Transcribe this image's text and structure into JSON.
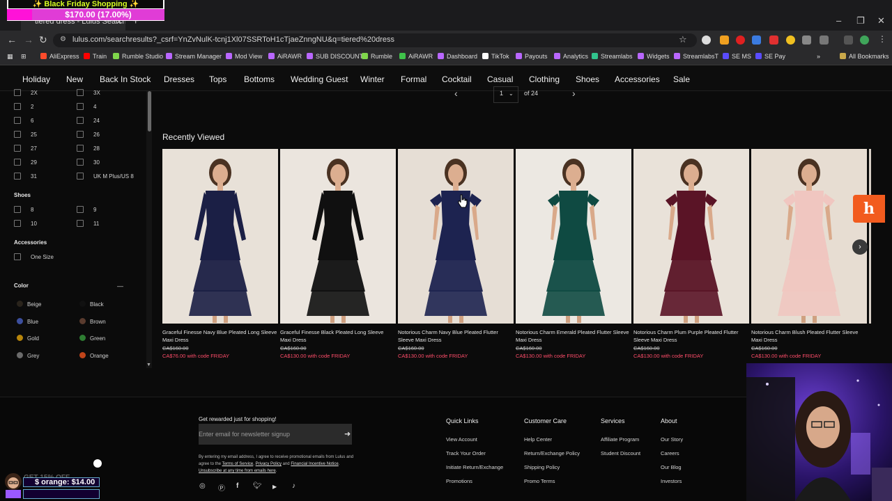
{
  "overlay": {
    "black_friday_title": "✨ Black Friday Shopping ✨",
    "black_friday_amount": "$170.00 (17.00%)",
    "promo_faint": "GET 15% OFF",
    "promo_line": "$ orange: $14.00"
  },
  "browser": {
    "tab_title": "tiered dress - Lulus Search",
    "url": "lulus.com/searchresults?_csrf=YnZvNulK-tcnj1Xl07SSRToH1cTjaeZnngNU&q=tiered%20dress",
    "bookmarks": [
      "AliExpress",
      "Train",
      "Rumble Studio",
      "Stream Manager",
      "Mod View",
      "AiRAWR",
      "SUB DISCOUNT",
      "Rumble",
      "AiRAWR",
      "Dashboard",
      "TikTok",
      "Payouts",
      "Analytics",
      "Streamlabs",
      "Widgets",
      "StreamlabsT",
      "SE MS",
      "SE Pay"
    ],
    "all_bookmarks": "All Bookmarks",
    "bookmark_colors": [
      "#ff4b2b",
      "#ff0000",
      "#7fd64b",
      "#b967ff",
      "#b967ff",
      "#b967ff",
      "#b967ff",
      "#7fd64b",
      "#3fc24a",
      "#b967ff",
      "#ffffff",
      "#b967ff",
      "#b967ff",
      "#31c48d",
      "#b967ff",
      "#b967ff",
      "#5a4cff",
      "#5a4cff"
    ]
  },
  "nav": {
    "items": [
      "Holiday",
      "New",
      "Back In Stock",
      "Dresses",
      "Tops",
      "Bottoms",
      "Wedding Guest",
      "Winter",
      "Formal",
      "Cocktail",
      "Casual",
      "Clothing",
      "Shoes",
      "Accessories",
      "Sale"
    ]
  },
  "sidebar": {
    "sizes_left": [
      "2X",
      "2",
      "6",
      "25",
      "27",
      "29",
      "31"
    ],
    "sizes_right": [
      "3X",
      "4",
      "24",
      "26",
      "28",
      "30",
      "UK M Plus/US 8"
    ],
    "shoes_heading": "Shoes",
    "shoes_left": [
      "8",
      "10"
    ],
    "shoes_right": [
      "9",
      "11"
    ],
    "accessories_heading": "Accessories",
    "accessories": [
      "One Size"
    ],
    "color_heading": "Color",
    "color_toggle": "—",
    "colors": [
      {
        "name": "Beige",
        "hex": "#2a241c"
      },
      {
        "name": "Black",
        "hex": "#111111"
      },
      {
        "name": "Blue",
        "hex": "#3c4f9e"
      },
      {
        "name": "Brown",
        "hex": "#5a3b2e"
      },
      {
        "name": "Gold",
        "hex": "#b8860b"
      },
      {
        "name": "Green",
        "hex": "#2e7d32"
      },
      {
        "name": "Grey",
        "hex": "#6b6b6b"
      },
      {
        "name": "Orange",
        "hex": "#c0441a"
      }
    ]
  },
  "pager": {
    "current": "1",
    "of_label": "of 24"
  },
  "recently_viewed": {
    "title": "Recently Viewed",
    "products": [
      {
        "name": "Graceful Finesse Navy Blue Pleated Long Sleeve Maxi Dress",
        "was": "CA$160.00",
        "now": "CA$76.00 with code FRIDAY",
        "dress": "#1b1f45",
        "bg": "#e8e1d8"
      },
      {
        "name": "Graceful Finesse Black Pleated Long Sleeve Maxi Dress",
        "was": "CA$160.00",
        "now": "CA$130.00 with code FRIDAY",
        "dress": "#101010",
        "bg": "#ebe5de"
      },
      {
        "name": "Notorious Charm Navy Blue Pleated Flutter Sleeve Maxi Dress",
        "was": "CA$160.00",
        "now": "CA$130.00 with code FRIDAY",
        "dress": "#1d2350",
        "bg": "#e6ded5"
      },
      {
        "name": "Notorious Charm Emerald Pleated Flutter Sleeve Maxi Dress",
        "was": "CA$160.00",
        "now": "CA$130.00 with code FRIDAY",
        "dress": "#0f4a42",
        "bg": "#ece8e2"
      },
      {
        "name": "Notorious Charm Plum Purple Pleated Flutter Sleeve Maxi Dress",
        "was": "CA$160.00",
        "now": "CA$130.00 with code FRIDAY",
        "dress": "#5a1426",
        "bg": "#e9e2d9"
      },
      {
        "name": "Notorious Charm Blush Pleated Flutter Sleeve Maxi Dress",
        "was": "CA$160.00",
        "now": "CA$130.00 with code FRIDAY",
        "dress": "#f0c6c0",
        "bg": "#e7ddd2"
      }
    ]
  },
  "footer": {
    "newsletter_title": "Get rewarded just for shopping!",
    "newsletter_placeholder": "Enter email for newsletter signup",
    "legal_1": "By entering my email address, I agree to receive promotional emails from Lulus and agree to the ",
    "legal_terms": "Terms of Service",
    "legal_comma": ", ",
    "legal_privacy": "Privacy Policy",
    "legal_and": " and ",
    "legal_financial": "Financial Incentive Notice",
    "legal_dot": ". ",
    "legal_unsub": "Unsubscribe at any time from emails here",
    "legal_end": ".",
    "columns": [
      {
        "heading": "Quick Links",
        "links": [
          "View Account",
          "Track Your Order",
          "Initiate Return/Exchange",
          "Promotions"
        ]
      },
      {
        "heading": "Customer Care",
        "links": [
          "Help Center",
          "Return/Exchange Policy",
          "Shipping Policy",
          "Promo Terms"
        ]
      },
      {
        "heading": "Services",
        "links": [
          "Affiliate Program",
          "Student Discount"
        ]
      },
      {
        "heading": "About",
        "links": [
          "Our Story",
          "Careers",
          "Our Blog",
          "Investors"
        ]
      }
    ]
  }
}
